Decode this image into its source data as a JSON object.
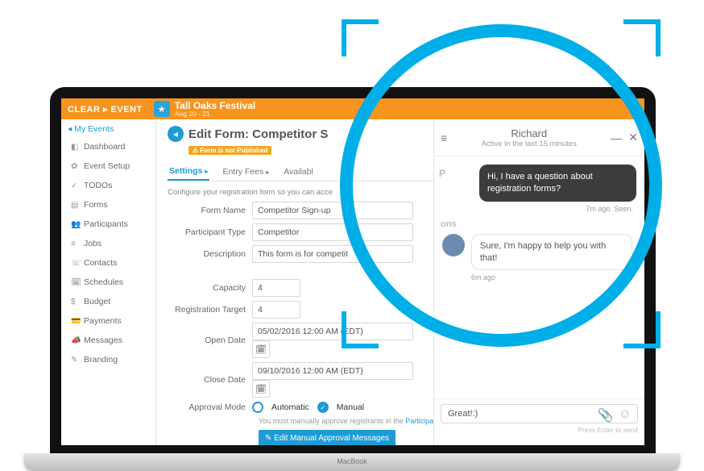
{
  "logo": "CLEAR ▸ EVENT",
  "event": {
    "title": "Tall Oaks Festival",
    "dates": "Aug 20 - 21"
  },
  "sidebar": {
    "back": "My Events",
    "items": [
      {
        "icon": "◧",
        "label": "Dashboard"
      },
      {
        "icon": "✿",
        "label": "Event Setup"
      },
      {
        "icon": "✓",
        "label": "TODOs"
      },
      {
        "icon": "▤",
        "label": "Forms"
      },
      {
        "icon": "👥",
        "label": "Participants"
      },
      {
        "icon": "≡",
        "label": "Jobs"
      },
      {
        "icon": "☏",
        "label": "Contacts"
      },
      {
        "icon": "🗓",
        "label": "Schedules"
      },
      {
        "icon": "$",
        "label": "Budget"
      },
      {
        "icon": "💳",
        "label": "Payments"
      },
      {
        "icon": "📣",
        "label": "Messages"
      },
      {
        "icon": "✎",
        "label": "Branding"
      }
    ]
  },
  "page": {
    "title": "Edit Form: Competitor S",
    "badge": "⚠ Form is not Published",
    "tabs": {
      "settings": "Settings",
      "entry_fees": "Entry Fees",
      "availabl": "Availabl"
    },
    "desc": "Configure your registration form so you can acce",
    "form": {
      "form_name": {
        "label": "Form Name",
        "value": "Competitor Sign-up"
      },
      "participant_type": {
        "label": "Participant Type",
        "value": "Competitor"
      },
      "description": {
        "label": "Description",
        "value": "This form is for competit"
      },
      "capacity": {
        "label": "Capacity",
        "value": "4"
      },
      "reg_target": {
        "label": "Registration Target",
        "value": "4"
      },
      "open_date": {
        "label": "Open Date",
        "value": "05/02/2016 12:00 AM (EDT)"
      },
      "close_date": {
        "label": "Close Date",
        "value": "09/10/2016 12:00 AM (EDT)"
      },
      "approval_mode": {
        "label": "Approval Mode",
        "automatic": "Automatic",
        "manual": "Manual",
        "note_prefix": "You must manually approve registrants in the ",
        "note_link": "Participant"
      },
      "edit_btn": "✎ Edit Manual Approval Messages"
    }
  },
  "chat": {
    "name": "Richard",
    "status": "Active in the last 15 minutes",
    "out": "Hi, I have a question about registration forms?",
    "out_meta": "7m ago. Seen.",
    "in": "Sure, I'm happy to help you with that!",
    "in_meta": "6m ago",
    "input": "Great!:) ",
    "hint": "Press Enter to send"
  },
  "laptop": "MacBook",
  "partial_label": {
    "p": "P",
    "ons": "ons"
  }
}
